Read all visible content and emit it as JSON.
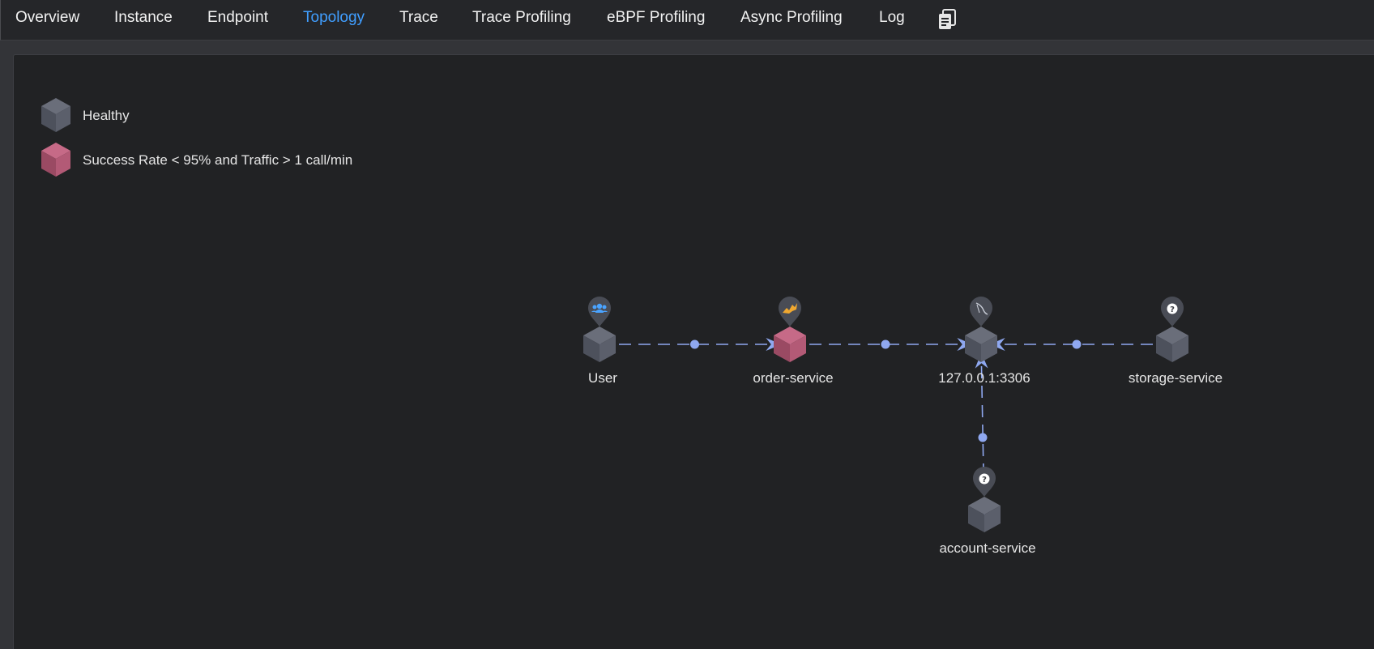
{
  "tabs": [
    {
      "label": "Overview",
      "active": false
    },
    {
      "label": "Instance",
      "active": false
    },
    {
      "label": "Endpoint",
      "active": false
    },
    {
      "label": "Topology",
      "active": true
    },
    {
      "label": "Trace",
      "active": false
    },
    {
      "label": "Trace Profiling",
      "active": false
    },
    {
      "label": "eBPF Profiling",
      "active": false
    },
    {
      "label": "Async Profiling",
      "active": false
    },
    {
      "label": "Log",
      "active": false
    }
  ],
  "tab_extra_icon": "document-copy-icon",
  "legend": [
    {
      "label": "Healthy",
      "color": "#565a66"
    },
    {
      "label": "Success Rate < 95% and Traffic > 1 call/min",
      "color": "#b35a76"
    }
  ],
  "topology": {
    "nodes": [
      {
        "id": "user",
        "label": "User",
        "status": "healthy",
        "icon": "users-icon"
      },
      {
        "id": "order",
        "label": "order-service",
        "status": "unhealthy",
        "icon": "tomcat-icon"
      },
      {
        "id": "mysql",
        "label": "127.0.0.1:3306",
        "status": "healthy",
        "icon": "mysql-icon"
      },
      {
        "id": "storage",
        "label": "storage-service",
        "status": "healthy",
        "icon": "unknown-icon"
      },
      {
        "id": "account",
        "label": "account-service",
        "status": "healthy",
        "icon": "unknown-icon"
      }
    ],
    "edges": [
      {
        "from": "user",
        "to": "order"
      },
      {
        "from": "order",
        "to": "mysql"
      },
      {
        "from": "storage",
        "to": "mysql"
      },
      {
        "from": "account",
        "to": "mysql"
      }
    ]
  },
  "colors": {
    "active_tab": "#409eff",
    "healthy": "#565a66",
    "unhealthy": "#b35a76",
    "edge": "#8fa8f0",
    "panel_bg": "#212224"
  }
}
